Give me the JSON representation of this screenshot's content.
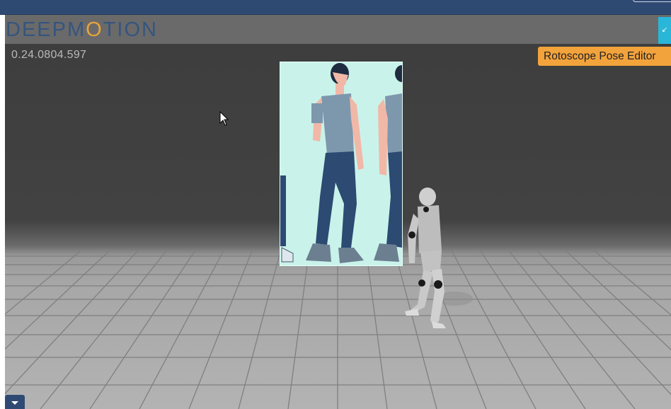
{
  "app": {
    "logo_text_pre": "DEEPM",
    "logo_text_dot": "O",
    "logo_text_post": "TION",
    "version": "0.24.0804.597"
  },
  "toolbar": {
    "editor_button_label": "Rotoscope Pose Editor"
  },
  "icons": {
    "exit_fullscreen": "collapse-arrows-icon",
    "dropdown": "chevron-down-icon",
    "cursor": "mouse-pointer-icon"
  },
  "colors": {
    "topbar": "#2f4a72",
    "accent_orange": "#f3a33c",
    "accent_cyan": "#29b6d8",
    "panel_bg": "#c9f3ea"
  }
}
